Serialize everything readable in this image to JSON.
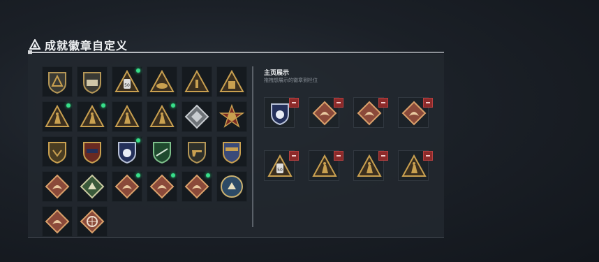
{
  "header": {
    "title": "成就徽章自定义"
  },
  "showcase": {
    "title": "主页展示",
    "subtitle": "拖拽想展示的徽章到栏位"
  },
  "colors": {
    "gold": "#c9a050",
    "bronze": "#8b4a3a",
    "navy": "#24305a",
    "green_dot": "#37e08a",
    "remove_red": "#8c2a2a"
  },
  "badges": [
    {
      "icon": "shield-badge-icon",
      "new": false
    },
    {
      "icon": "vehicle-badge-icon",
      "new": false
    },
    {
      "icon": "kit-50-badge-icon",
      "new": true
    },
    {
      "icon": "boat-badge-icon",
      "new": false
    },
    {
      "icon": "rank-1-badge-icon",
      "new": false
    },
    {
      "icon": "canister-badge-icon",
      "new": false
    },
    {
      "icon": "soldier-badge-icon",
      "new": true
    },
    {
      "icon": "parachute-badge-icon",
      "new": true
    },
    {
      "icon": "squad-badge-icon",
      "new": false
    },
    {
      "icon": "tower-badge-icon",
      "new": true
    },
    {
      "icon": "silver-diamond-badge-icon",
      "new": false
    },
    {
      "icon": "star-emblem-badge-icon",
      "new": false
    },
    {
      "icon": "eagle-shield-badge-icon",
      "new": false
    },
    {
      "icon": "stars-shield-badge-icon",
      "new": false
    },
    {
      "icon": "police-shield-badge-icon",
      "new": true
    },
    {
      "icon": "rifle-green-badge-icon",
      "new": false
    },
    {
      "icon": "pistol-badge-icon",
      "new": false
    },
    {
      "icon": "crest-badge-icon",
      "new": false
    },
    {
      "icon": "wolf-badge-icon",
      "new": false
    },
    {
      "icon": "warrior-green-badge-icon",
      "new": false
    },
    {
      "icon": "dragon-badge-icon",
      "new": true
    },
    {
      "icon": "dragon-red-badge-icon",
      "new": true
    },
    {
      "icon": "runner-badge-icon",
      "new": true
    },
    {
      "icon": "round-emblem-badge-icon",
      "new": false
    },
    {
      "icon": "beast-badge-icon",
      "new": false
    },
    {
      "icon": "wheel-badge-icon",
      "new": false
    }
  ],
  "showcase_slots": [
    {
      "icon": "police-shield-badge-icon"
    },
    {
      "icon": "dragon-badge-icon"
    },
    {
      "icon": "dragon-red-badge-icon"
    },
    {
      "icon": "runner-badge-icon"
    },
    {
      "icon": "kit-50-badge-icon"
    },
    {
      "icon": "tower-badge-icon"
    },
    {
      "icon": "soldier-badge-icon"
    },
    {
      "icon": "parachute-badge-icon"
    }
  ]
}
